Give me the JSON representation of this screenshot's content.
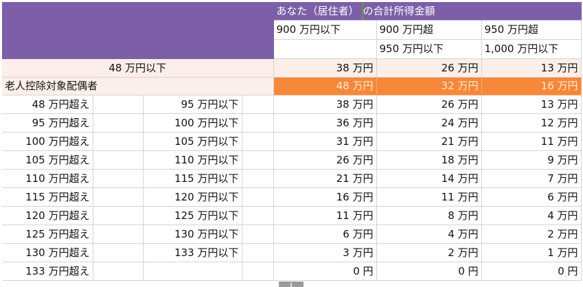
{
  "header": {
    "title_part1": "あなた（居住者）",
    "title_part2": "の合計所得金額",
    "col1_line1": "900 万円以下",
    "col2_line1": "900 万円超",
    "col2_line2": "950 万円以下",
    "col3_line1": "950 万円超",
    "col3_line2": "1,000 万円以下"
  },
  "row_48_label": "48 万円以下",
  "row_48_values": [
    "38 万円",
    "26 万円",
    "13 万円"
  ],
  "elder_label": "老人控除対象配偶者",
  "elder_values": [
    "48 万円",
    "32 万円",
    "16 万円"
  ],
  "rows": [
    {
      "from": "48 万円超え",
      "to": "95 万円以下",
      "v": [
        "38 万円",
        "26 万円",
        "13 万円"
      ]
    },
    {
      "from": "95 万円超え",
      "to": "100 万円以下",
      "v": [
        "36 万円",
        "24 万円",
        "12 万円"
      ]
    },
    {
      "from": "100 万円超え",
      "to": "105 万円以下",
      "v": [
        "31 万円",
        "21 万円",
        "11 万円"
      ]
    },
    {
      "from": "105 万円超え",
      "to": "110 万円以下",
      "v": [
        "26 万円",
        "18 万円",
        "9 万円"
      ]
    },
    {
      "from": "110 万円超え",
      "to": "115 万円以下",
      "v": [
        "21 万円",
        "14 万円",
        "7 万円"
      ]
    },
    {
      "from": "115 万円超え",
      "to": "120 万円以下",
      "v": [
        "16 万円",
        "11 万円",
        "6 万円"
      ]
    },
    {
      "from": "120 万円超え",
      "to": "125 万円以下",
      "v": [
        "11 万円",
        "8 万円",
        "4 万円"
      ]
    },
    {
      "from": "125 万円超え",
      "to": "130 万円以下",
      "v": [
        "6 万円",
        "4 万円",
        "2 万円"
      ]
    },
    {
      "from": "130 万円超え",
      "to": "133 万円以下",
      "v": [
        "3 万円",
        "2 万円",
        "1 万円"
      ]
    },
    {
      "from": "133 万円超え",
      "to": "",
      "v": [
        "0 円",
        "0 円",
        "0 円"
      ]
    }
  ],
  "colors": {
    "header_purple": "#7d5fa7",
    "highlight_orange": "#f6883a",
    "pink_row": "#fceee9"
  }
}
